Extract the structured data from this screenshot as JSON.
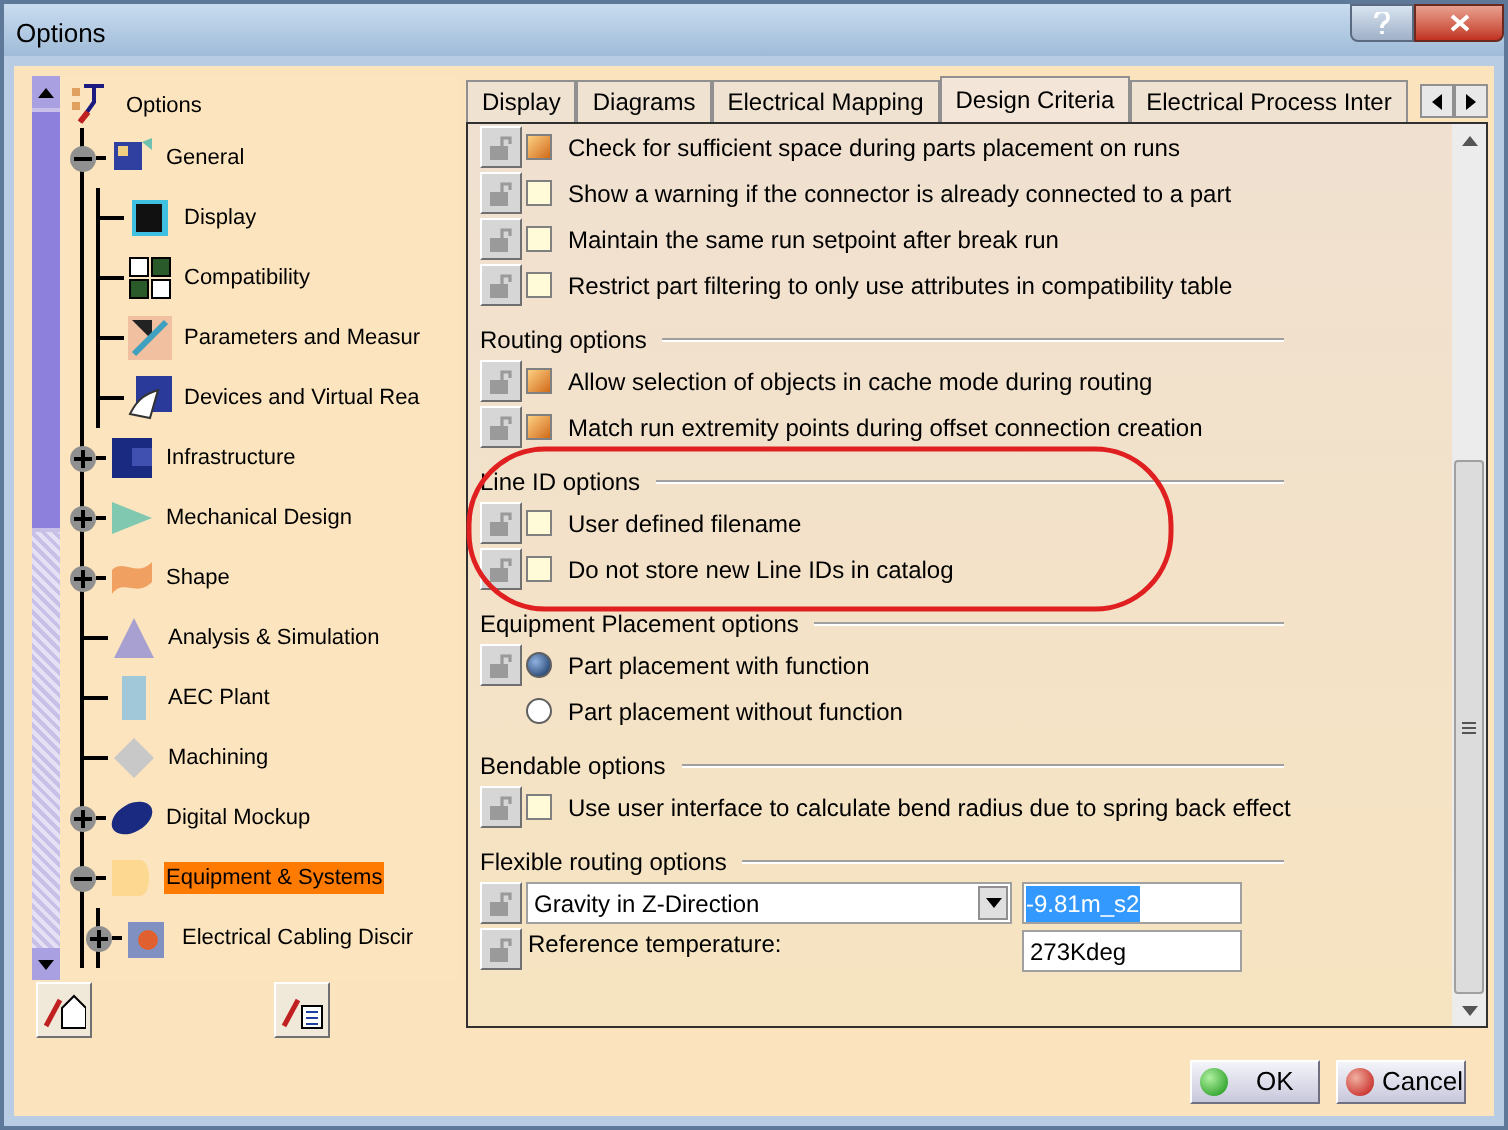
{
  "window": {
    "title": "Options"
  },
  "tree": {
    "label": "Options",
    "selected": false,
    "children": [
      {
        "label": "General",
        "expanded": true,
        "selected": false,
        "children": [
          {
            "label": "Display",
            "selected": false
          },
          {
            "label": "Compatibility",
            "selected": false
          },
          {
            "label": "Parameters and Measur",
            "selected": false
          },
          {
            "label": "Devices and Virtual Rea",
            "selected": false
          }
        ]
      },
      {
        "label": "Infrastructure",
        "expanded": false,
        "selected": false
      },
      {
        "label": "Mechanical Design",
        "expanded": false,
        "selected": false
      },
      {
        "label": "Shape",
        "expanded": false,
        "selected": false
      },
      {
        "label": "Analysis & Simulation",
        "selected": false
      },
      {
        "label": "AEC Plant",
        "selected": false
      },
      {
        "label": "Machining",
        "selected": false
      },
      {
        "label": "Digital Mockup",
        "expanded": false,
        "selected": false
      },
      {
        "label": "Equipment & Systems",
        "expanded": true,
        "selected": true,
        "children": [
          {
            "label": "Electrical Cabling Discir",
            "expanded": false,
            "selected": false
          }
        ]
      }
    ]
  },
  "tabs": [
    {
      "label": "Display",
      "selected": false
    },
    {
      "label": "Diagrams",
      "selected": false
    },
    {
      "label": "Electrical Mapping",
      "selected": false
    },
    {
      "label": "Design Criteria",
      "selected": true
    },
    {
      "label": "Electrical Process Inter",
      "selected": false
    }
  ],
  "sections": [
    {
      "rows": [
        {
          "kind": "checkbox",
          "lock": true,
          "label": "Check for sufficient space during parts placement on runs",
          "checked": true
        },
        {
          "kind": "checkbox",
          "lock": true,
          "label": "Show a warning if the connector is already connected to a part",
          "checked": false
        },
        {
          "kind": "checkbox",
          "lock": true,
          "label": "Maintain the same run setpoint after break run",
          "checked": false
        },
        {
          "kind": "checkbox",
          "lock": true,
          "label": "Restrict part filtering to only use attributes in compatibility table",
          "checked": false
        }
      ]
    },
    {
      "title": "Routing options",
      "rows": [
        {
          "kind": "checkbox",
          "lock": true,
          "label": "Allow selection of objects in cache mode during routing",
          "checked": true
        },
        {
          "kind": "checkbox",
          "lock": true,
          "label": "Match run extremity points during offset connection creation",
          "checked": true
        }
      ]
    },
    {
      "title": "Line ID options",
      "highlighted": true,
      "rows": [
        {
          "kind": "checkbox",
          "lock": true,
          "label": "User defined filename",
          "checked": false
        },
        {
          "kind": "checkbox",
          "lock": true,
          "label": "Do not store new Line IDs in catalog",
          "checked": false
        }
      ]
    },
    {
      "title": "Equipment Placement options",
      "rows": [
        {
          "kind": "radio",
          "lock": true,
          "label": "Part placement with function",
          "selected": true
        },
        {
          "kind": "radio",
          "lock": false,
          "label": "Part placement without function",
          "selected": false
        }
      ]
    },
    {
      "title": "Bendable options",
      "rows": [
        {
          "kind": "checkbox",
          "lock": true,
          "label": "Use user interface to calculate bend radius due to spring back effect",
          "checked": false
        }
      ]
    },
    {
      "title": "Flexible routing options",
      "rows": [
        {
          "kind": "combo",
          "lock": true,
          "label": "Gravity in Z-Direction",
          "value": "-9.81m_s2"
        },
        {
          "kind": "labeled_field",
          "lock": true,
          "label": "Reference temperature:",
          "value": "273Kdeg"
        }
      ]
    }
  ],
  "buttons": [
    {
      "label": "OK",
      "kind": "ok"
    },
    {
      "label": "Cancel",
      "kind": "cancel"
    }
  ]
}
